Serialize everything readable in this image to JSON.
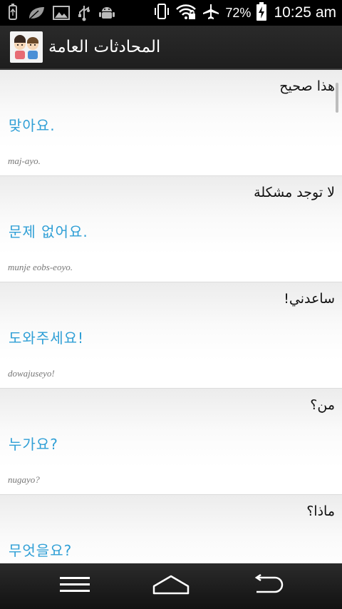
{
  "status_bar": {
    "battery_percent": "72%",
    "time": "10:25 am",
    "icons": [
      "usb-icon",
      "leaf-icon",
      "image-icon",
      "usb-debug-icon",
      "android-icon",
      "vibrate-icon",
      "wifi-icon",
      "airplane-icon",
      "battery-charging-icon"
    ]
  },
  "action_bar": {
    "title": "المحادثات العامة",
    "logo_icon": "two-kids-icon"
  },
  "phrases": [
    {
      "arabic": "هذا صحيح",
      "korean": "맞아요.",
      "romanization": "maj-ayo."
    },
    {
      "arabic": "لا توجد مشكلة",
      "korean": "문제 없어요.",
      "romanization": "munje eobs-eoyo."
    },
    {
      "arabic": "ساعدني!",
      "korean": "도와주세요!",
      "romanization": "dowajuseyo!"
    },
    {
      "arabic": "من؟",
      "korean": "누가요?",
      "romanization": "nugayo?"
    },
    {
      "arabic": "ماذا؟",
      "korean": "무엇을요?",
      "romanization": ""
    }
  ],
  "nav_bar": {
    "icons": [
      "menu-icon",
      "home-icon",
      "back-icon"
    ]
  }
}
